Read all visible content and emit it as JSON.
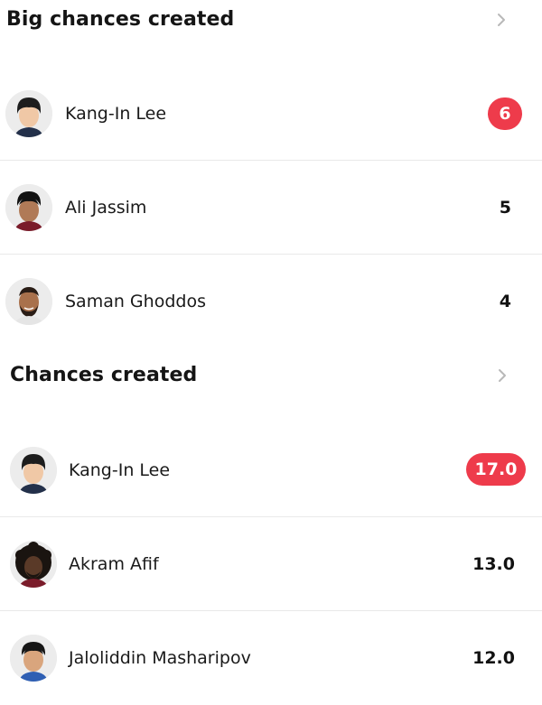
{
  "sections": [
    {
      "title": "Big chances created",
      "players": [
        {
          "name": "Kang-In Lee",
          "value": "6",
          "highlight": true
        },
        {
          "name": "Ali Jassim",
          "value": "5",
          "highlight": false
        },
        {
          "name": "Saman Ghoddos",
          "value": "4",
          "highlight": false
        }
      ]
    },
    {
      "title": "Chances created",
      "players": [
        {
          "name": "Kang-In Lee",
          "value": "17.0",
          "highlight": true
        },
        {
          "name": "Akram Afif",
          "value": "13.0",
          "highlight": false
        },
        {
          "name": "Jaloliddin Masharipov",
          "value": "12.0",
          "highlight": false
        }
      ]
    }
  ],
  "colors": {
    "highlight": "#ee3b4b",
    "divider": "#e9e9e9",
    "chevron": "#b8b8b8"
  },
  "icons": {
    "chevron": "chevron-right-icon",
    "avatar": "player-avatar"
  }
}
